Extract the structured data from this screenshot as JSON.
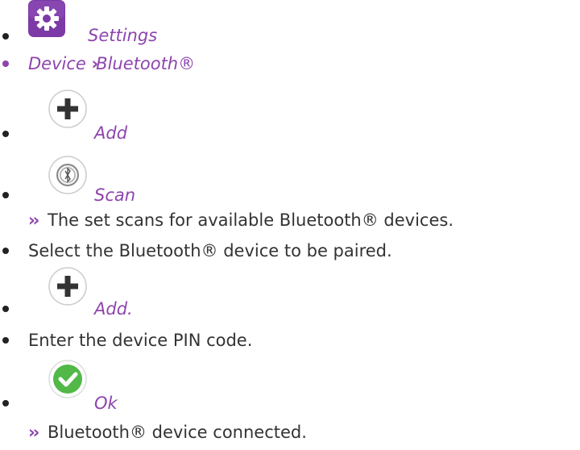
{
  "steps": [
    {
      "label": "Settings",
      "icon": "settings-icon"
    },
    {
      "path": {
        "part1": "Device",
        "separator": "›",
        "part2": "Bluetooth®"
      }
    },
    {
      "label": "Add",
      "icon": "plus-icon"
    },
    {
      "label": "Scan",
      "icon": "bluetooth-scan-icon"
    },
    {
      "result": {
        "arrow": "››",
        "text": "The set scans for available Bluetooth® devices."
      }
    },
    {
      "text": "Select the Bluetooth® device to be paired."
    },
    {
      "label": "Add.",
      "icon": "plus-icon"
    },
    {
      "text": "Enter the device PIN code."
    },
    {
      "label": "Ok",
      "icon": "check-icon"
    },
    {
      "result": {
        "arrow": "››",
        "text": "Bluetooth® device connected."
      }
    }
  ],
  "colors": {
    "accent": "#8e44ad",
    "ok_green": "#52b848",
    "text": "#333333"
  }
}
